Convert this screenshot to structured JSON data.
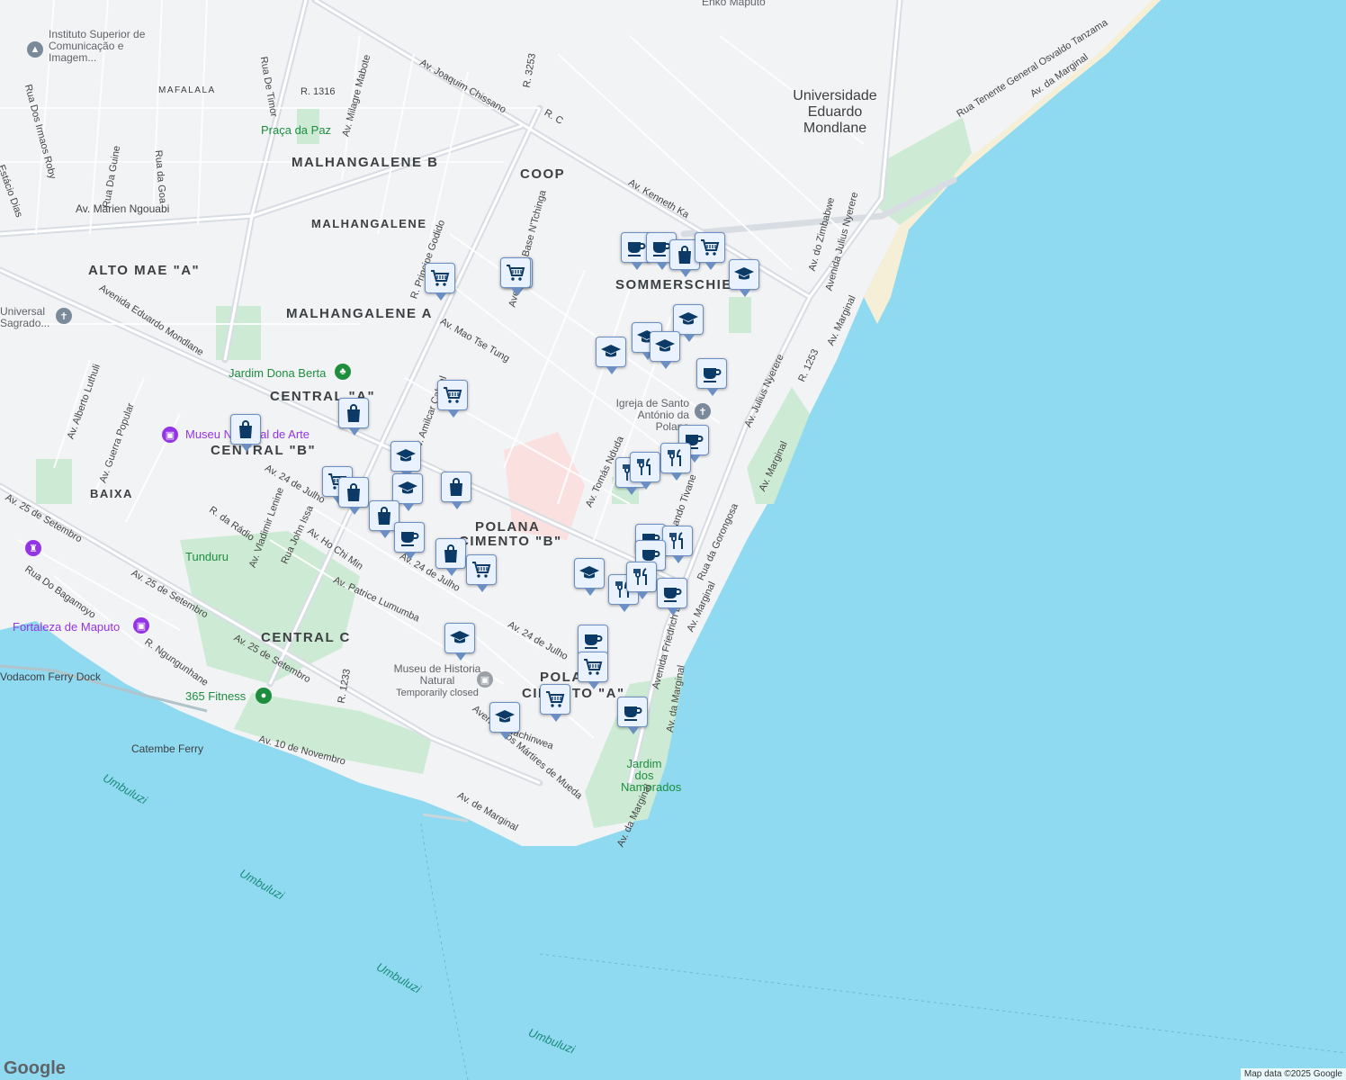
{
  "colors": {
    "water": "#8fdaf0",
    "land": "#f2f3f5",
    "park": "#cdebd4",
    "road": "#ffffff",
    "arterial": "#d8dde4",
    "marker_fill": "#eaf2ff",
    "marker_icon": "#0b3a66"
  },
  "districts": [
    {
      "id": "malhangalene-b",
      "text": "MALHANGALENE B"
    },
    {
      "id": "malhangalene",
      "text": "MALHANGALENE"
    },
    {
      "id": "alto-mae-a",
      "text": "ALTO MAE \"A\""
    },
    {
      "id": "malhangalene-a",
      "text": "MALHANGALENE A"
    },
    {
      "id": "central-a",
      "text": "CENTRAL \"A\""
    },
    {
      "id": "central-b",
      "text": "CENTRAL \"B\""
    },
    {
      "id": "baixa",
      "text": "BAIXA"
    },
    {
      "id": "polana-b1",
      "text": "POLANA"
    },
    {
      "id": "polana-b2",
      "text": "CIMENTO \"B\""
    },
    {
      "id": "central-c",
      "text": "CENTRAL C"
    },
    {
      "id": "polana-a1",
      "text": "POLANA"
    },
    {
      "id": "polana-a2",
      "text": "CIMENTO \"A\""
    },
    {
      "id": "coop",
      "text": "COOP"
    },
    {
      "id": "sommerschield",
      "text": "SOMMERSCHIELD"
    },
    {
      "id": "mafalala",
      "text": "MAFALALA"
    }
  ],
  "places": {
    "instituto": "Instituto Superior de Comunicação e Imagem...",
    "praca": "Praça da Paz",
    "universal": "Universal Sagrado...",
    "jardim_berta": "Jardim Dona Berta",
    "museu_arte": "Museu Nacional de Arte",
    "tunduru": "Tunduru",
    "fortaleza": "Fortaleza de Maputo",
    "museu_historia": "Museu de Historia Natural",
    "temp_closed": "Temporarily closed",
    "fitness": "365 Fitness",
    "ferry_dock": "Vodacom Ferry Dock",
    "catembe": "Catembe Ferry",
    "jardim_namorados": "Jardim dos Namorados",
    "igreja": "Igreja de Santo António da Polana",
    "universidade": "Universidade Eduardo Mondlane",
    "enko": "Enko Maputo"
  },
  "streets": [
    "Av. Joaquim Chissano",
    "R. 3253",
    "R. C",
    "Av. Kenneth Ka",
    "Av. Marien Ngouabi",
    "Avenida Eduardo Mondlane",
    "Av. Mao Tse Tung",
    "R. 1316",
    "Av. Milagre Mabote",
    "Rua De Timor",
    "Rua Dos Irmaos Roby",
    "Rua Da Guine",
    "Rua da Goa",
    "Av. Vladimir Lenine",
    "Avenida da Base N'Tchinga",
    "R. Principe Godido",
    "Av. Tomás Nduda",
    "Av. Alberto Luthuli",
    "Av. Guerra Popular",
    "Av. 24 de Julho",
    "R. da Rádio",
    "Rua John Issa",
    "Av. Ho Chi Min",
    "Av. Patrice Lumumba",
    "Av. 25 de Setembro",
    "Rua Do Bagamoyo",
    "R. Ngungunhane",
    "R. 1233",
    "Av. 10 de Novembro",
    "Avenida dos Mártires de Mueda",
    "Av. de Marginal",
    "Av. da Marginal",
    "Av. Marginal",
    "Av. Julius Nyerere",
    "Avenida Julius Nyerere",
    "Av. do Zimbabwe",
    "R. 1253",
    "Rua Tenente General Osvaldo Tanzama",
    "Av. da Marginal",
    "Avenida Friedrich Engels",
    "Rua da Gorongosa",
    "Av. Julius Nyerere",
    "R. Nachinwea",
    "Av. Amilcar Cabral",
    "Fernando Tivane",
    "Rua Dos Irmaos Roby",
    "Estácio Dias"
  ],
  "water_labels": [
    "Umbuluzi",
    "Umbuluzi",
    "Umbuluzi",
    "Umbuluzi"
  ],
  "markers": [
    {
      "type": "cafe"
    },
    {
      "type": "cafe"
    },
    {
      "type": "shopping"
    },
    {
      "type": "grocery"
    },
    {
      "type": "school"
    },
    {
      "type": "grocery"
    },
    {
      "type": "grocery"
    },
    {
      "type": "school"
    },
    {
      "type": "school"
    },
    {
      "type": "school"
    },
    {
      "type": "school"
    },
    {
      "type": "cafe"
    },
    {
      "type": "grocery"
    },
    {
      "type": "shopping"
    },
    {
      "type": "shopping"
    },
    {
      "type": "cafe"
    },
    {
      "type": "restaurant"
    },
    {
      "type": "restaurant"
    },
    {
      "type": "restaurant"
    },
    {
      "type": "school"
    },
    {
      "type": "grocery"
    },
    {
      "type": "shopping"
    },
    {
      "type": "school"
    },
    {
      "type": "shopping"
    },
    {
      "type": "shopping"
    },
    {
      "type": "cafe"
    },
    {
      "type": "shopping"
    },
    {
      "type": "grocery"
    },
    {
      "type": "cafe"
    },
    {
      "type": "restaurant"
    },
    {
      "type": "cafe"
    },
    {
      "type": "school"
    },
    {
      "type": "restaurant"
    },
    {
      "type": "restaurant"
    },
    {
      "type": "cafe"
    },
    {
      "type": "cafe"
    },
    {
      "type": "grocery"
    },
    {
      "type": "school"
    },
    {
      "type": "grocery"
    },
    {
      "type": "cafe"
    },
    {
      "type": "school"
    },
    {
      "type": "grocery"
    }
  ],
  "footer": {
    "logo": "Google",
    "attribution": "Map data ©2025 Google"
  }
}
